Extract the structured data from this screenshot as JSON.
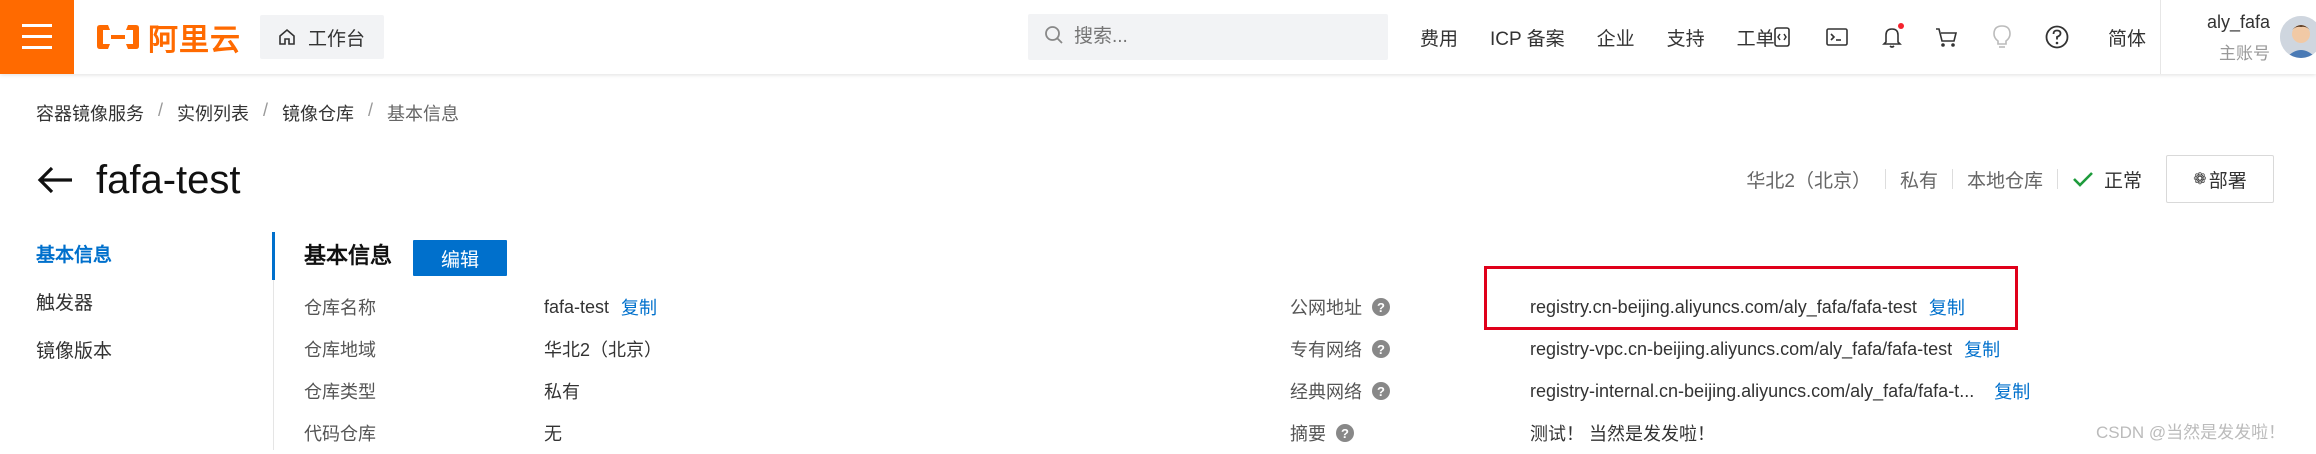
{
  "topbar": {
    "logo_text": "阿里云",
    "workbench_label": "工作台",
    "search_placeholder": "搜索...",
    "links": [
      "费用",
      "ICP 备案",
      "企业",
      "支持",
      "工单"
    ],
    "icons": [
      "code-icon",
      "terminal-icon",
      "bell-icon",
      "cart-icon",
      "lightbulb-icon",
      "help-icon"
    ],
    "language": "简体",
    "user_name": "aly_fafa",
    "user_role": "主账号"
  },
  "breadcrumb": [
    "容器镜像服务",
    "实例列表",
    "镜像仓库",
    "基本信息"
  ],
  "page": {
    "title": "fafa-test",
    "region": "华北2（北京）",
    "visibility": "私有",
    "repo_kind": "本地仓库",
    "status": "正常",
    "deploy_label": "部署"
  },
  "sidenav": {
    "items": [
      "基本信息",
      "触发器",
      "镜像版本"
    ],
    "active_index": 0
  },
  "info": {
    "section_title": "基本信息",
    "edit_label": "编辑",
    "copy_label": "复制",
    "left": [
      {
        "label": "仓库名称",
        "value": "fafa-test"
      },
      {
        "label": "仓库地域",
        "value": "华北2（北京）"
      },
      {
        "label": "仓库类型",
        "value": "私有"
      },
      {
        "label": "代码仓库",
        "value": "无"
      }
    ],
    "right": [
      {
        "label": "公网地址",
        "value": "registry.cn-beijing.aliyuncs.com/aly_fafa/fafa-test"
      },
      {
        "label": "专有网络",
        "value": "registry-vpc.cn-beijing.aliyuncs.com/aly_fafa/fafa-test"
      },
      {
        "label": "经典网络",
        "value": "registry-internal.cn-beijing.aliyuncs.com/aly_fafa/fafa-t..."
      },
      {
        "label": "摘要",
        "value": "测试！ 当然是发发啦！"
      }
    ]
  },
  "watermark": "CSDN @当然是发发啦！",
  "colors": {
    "brand": "#ff6a00",
    "link": "#0070cc",
    "success": "#1e9b3c",
    "highlight": "#e0001a"
  }
}
